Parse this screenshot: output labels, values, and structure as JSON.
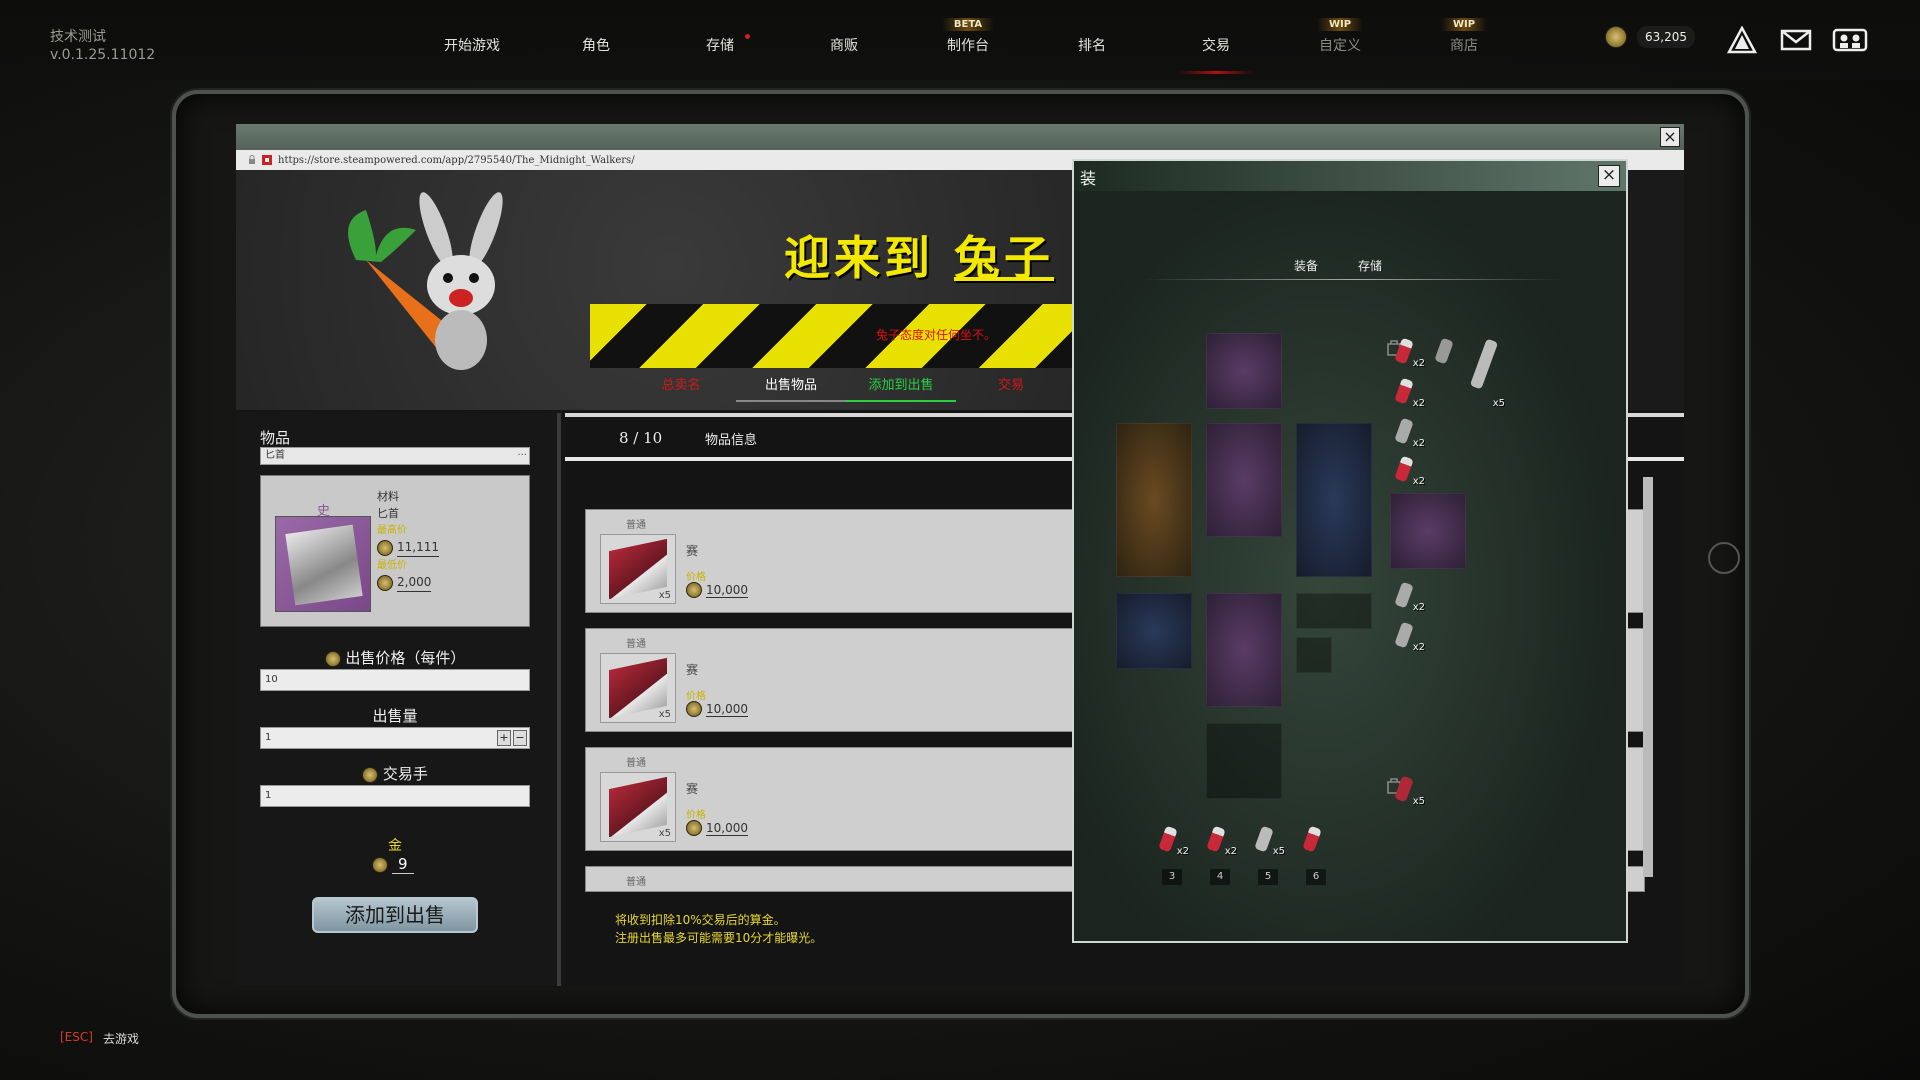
{
  "version": {
    "line1": "技术测试",
    "line2": "v.0.1.25.11012"
  },
  "nav": [
    {
      "label": "开始游戏"
    },
    {
      "label": "角色"
    },
    {
      "label": "存储",
      "dot": true
    },
    {
      "label": "商贩"
    },
    {
      "label": "制作台",
      "badge": "BETA"
    },
    {
      "label": "排名"
    },
    {
      "label": "交易",
      "active": true
    },
    {
      "label": "自定义",
      "badge": "WIP",
      "dim": true
    },
    {
      "label": "商店",
      "badge": "WIP",
      "dim": true
    }
  ],
  "currency": {
    "value": "63,205"
  },
  "browser": {
    "url": "https://store.steampowered.com/app/2795540/The_Midnight_Walkers/"
  },
  "banner": {
    "welcome_a": "迎来到",
    "welcome_b": "兔子",
    "hazard_text": "兔子态度对任何坐不。",
    "tabs": [
      {
        "label": "总卖名",
        "style": "red"
      },
      {
        "label": "出售物品",
        "style": "white"
      },
      {
        "label": "添加到出售",
        "style": "green"
      },
      {
        "label": "交易",
        "style": "red"
      }
    ]
  },
  "sell_form": {
    "items_label": "物品",
    "search_value": "匕首",
    "item": {
      "rarity": "史",
      "category": "材料",
      "name": "匕首",
      "high_label": "最高价",
      "high_price": "11,111",
      "low_label": "最低价",
      "low_price": "2,000"
    },
    "price_label": "出售价格（每件）",
    "price_value": "10",
    "qty_label": "出售量",
    "qty_value": "1",
    "stepper_plus": "+",
    "stepper_minus": "−",
    "fee_label": "交易手",
    "fee_value": "1",
    "gold_label": "金",
    "gold_value": "9",
    "submit_label": "添加到出售"
  },
  "listings": {
    "count": "8 / 10",
    "info_label": "物品信息",
    "items": [
      {
        "tag": "普通",
        "qty": "x5",
        "name": "赛",
        "price_label": "价格",
        "price": "10,000"
      },
      {
        "tag": "普通",
        "qty": "x5",
        "name": "赛",
        "price_label": "价格",
        "price": "10,000"
      },
      {
        "tag": "普通",
        "qty": "x5",
        "name": "赛",
        "price_label": "价格",
        "price": "10,000"
      },
      {
        "tag": "普通",
        "qty": "",
        "name": "",
        "price_label": "",
        "price": ""
      }
    ],
    "note1": "将收到扣除10%交易后的算金。",
    "note2": "注册出售最多可能需要10分才能曝光。"
  },
  "equipment": {
    "title": "装",
    "tab_equip": "装备",
    "tab_storage": "存储",
    "hotkeys": [
      "3",
      "4",
      "5",
      "6"
    ],
    "hotbar_qty": [
      "x2",
      "x2",
      "x5",
      ""
    ],
    "inventory": [
      {
        "qty": "x2"
      },
      {
        "qty": ""
      },
      {
        "qty": "x5"
      },
      {
        "qty": "x2"
      },
      {
        "qty": "x2"
      },
      {
        "qty": "x2"
      },
      {
        "qty": "x2"
      },
      {
        "qty": "x2"
      },
      {
        "qty": "x5"
      }
    ]
  },
  "footer": {
    "esc_key": "[ESC]",
    "esc_label": "去游戏"
  },
  "colors": {
    "accent_red": "#d01818",
    "gold": "#e8d830",
    "hazard_yellow": "#e8e000",
    "active_green": "#2ad040"
  }
}
